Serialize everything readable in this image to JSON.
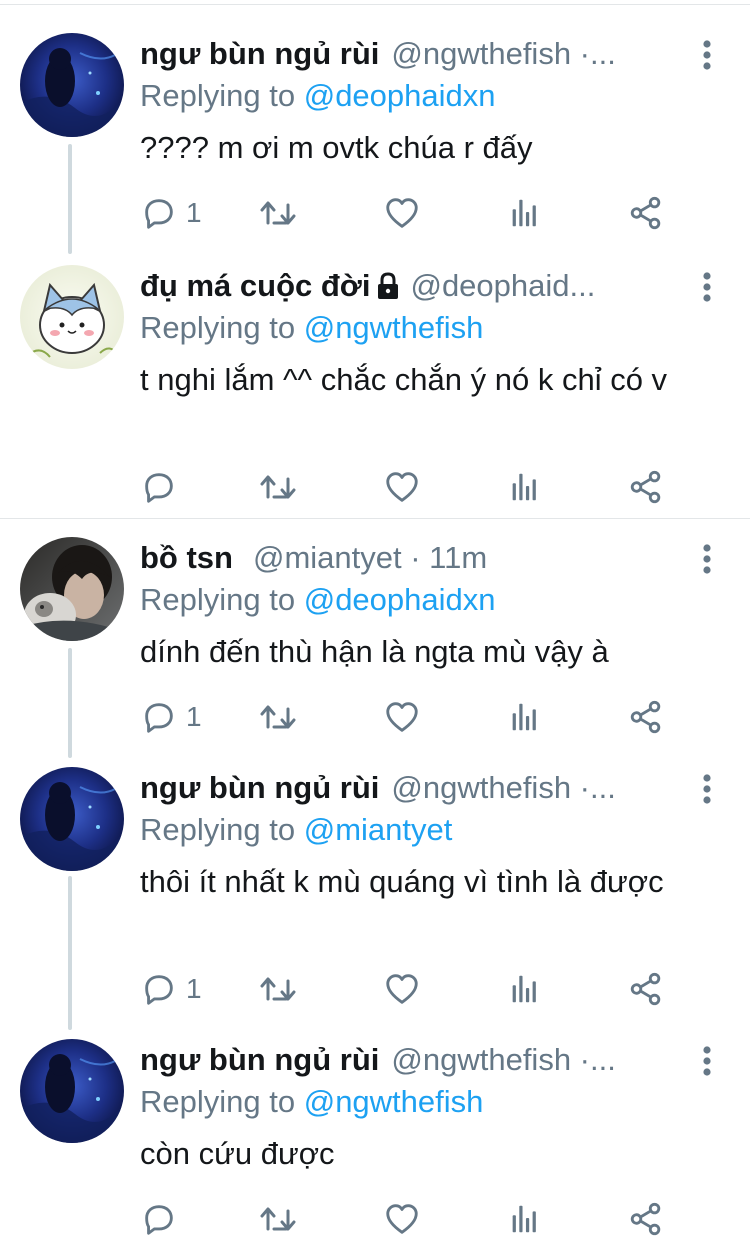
{
  "colors": {
    "text": "#14171a",
    "secondary": "#657786",
    "link": "#1da1f2",
    "divider": "#e3e6e8",
    "thread": "#cfd9de"
  },
  "icons": [
    "more-icon",
    "reply-icon",
    "retweet-icon",
    "like-icon",
    "analytics-icon",
    "share-icon",
    "lock-icon"
  ],
  "replying_prefix": "Replying to",
  "tweets": [
    {
      "name": "ngư bùn ngủ rùi",
      "handle": "@ngwthefish ·...",
      "replying_to": "@deophaidxn",
      "text": "???? m ơi m ovtk chúa r đấy",
      "reply_count": "1"
    },
    {
      "name": "đụ má cuộc đời",
      "handle": "@deophaid...",
      "replying_to": "@ngwthefish",
      "text": "t nghi lắm ^^ chắc chắn ý nó k chỉ có v",
      "reply_count": ""
    },
    {
      "name": "bồ tsn",
      "handle": "@miantyet · 11m",
      "replying_to": "@deophaidxn",
      "text": "dính đến thù hận là ngta mù vậy à",
      "reply_count": "1"
    },
    {
      "name": "ngư bùn ngủ rùi",
      "handle": "@ngwthefish ·...",
      "replying_to": "@miantyet",
      "text": "thôi ít nhất k mù quáng vì tình là được",
      "reply_count": "1"
    },
    {
      "name": "ngư bùn ngủ rùi",
      "handle": "@ngwthefish ·...",
      "replying_to": "@ngwthefish",
      "text": "còn cứu được",
      "reply_count": ""
    }
  ]
}
